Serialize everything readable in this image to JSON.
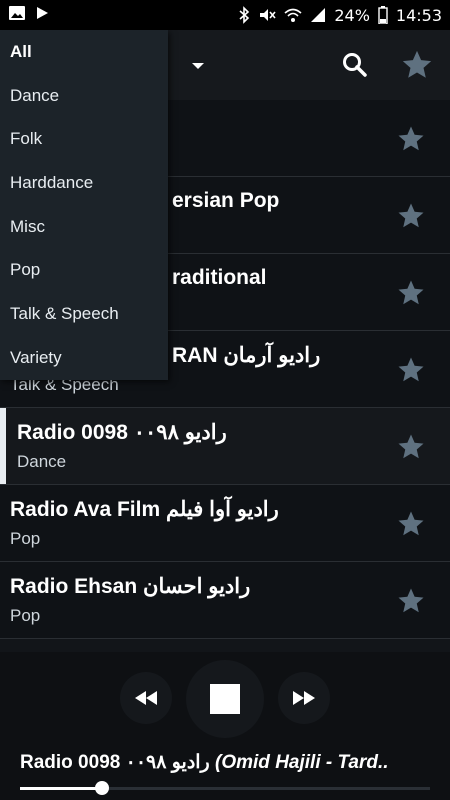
{
  "status": {
    "battery": "24%",
    "time": "14:53",
    "icons_left": [
      "image-icon",
      "play-icon"
    ],
    "icons_right": [
      "bluetooth-icon",
      "mute-icon",
      "wifi-icon",
      "signal-icon",
      "battery-icon"
    ]
  },
  "menu": {
    "items": [
      {
        "label": "All",
        "selected": true
      },
      {
        "label": "Dance"
      },
      {
        "label": "Folk"
      },
      {
        "label": "Harddance"
      },
      {
        "label": "Misc"
      },
      {
        "label": "Pop"
      },
      {
        "label": "Talk & Speech"
      },
      {
        "label": "Variety"
      }
    ]
  },
  "stations": [
    {
      "title": "",
      "genre": ""
    },
    {
      "title": "ersian Pop",
      "genre": ""
    },
    {
      "title": "raditional",
      "genre": ""
    },
    {
      "title": "RAN رادیو آرمان",
      "genre": "Talk & Speech"
    },
    {
      "title": "Radio 0098 رادیو ۰۰۹۸",
      "genre": "Dance"
    },
    {
      "title": "Radio Ava Film رادیو آوا فیلم",
      "genre": "Pop"
    },
    {
      "title": "Radio Ehsan رادیو احسان",
      "genre": "Pop"
    }
  ],
  "player": {
    "station": "Radio 0098 رادیو ۰۰۹۸",
    "track": "(Omid Hajili - Tard..",
    "progress": 0.2
  },
  "colors": {
    "accent_star": "#5f7180",
    "menu_bg": "#1c2329"
  }
}
